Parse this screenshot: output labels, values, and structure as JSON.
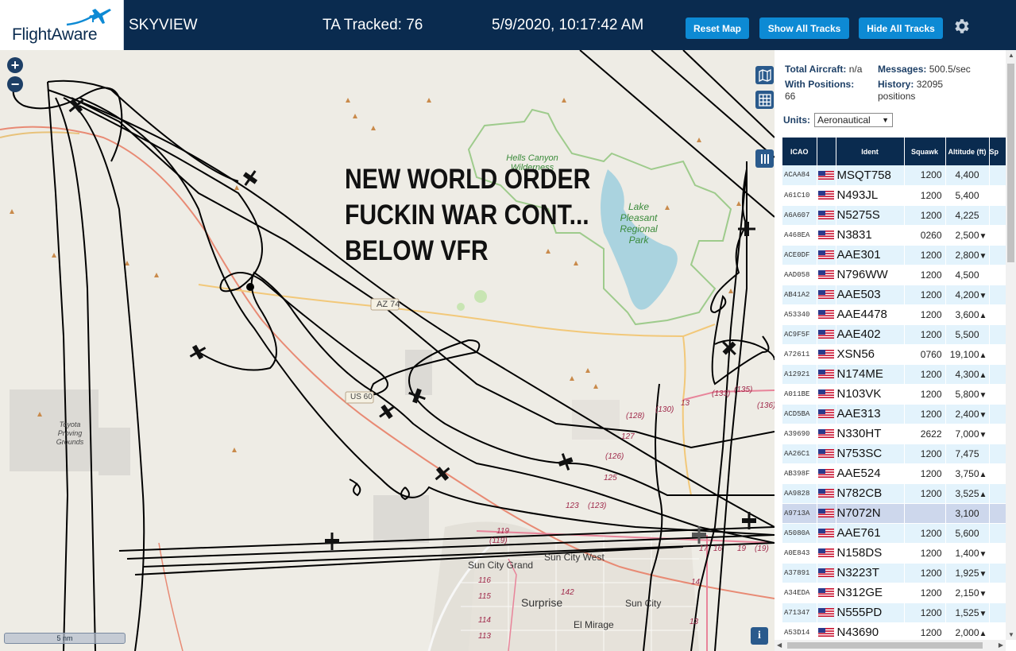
{
  "header": {
    "logo_text": "FlightAware",
    "app_name": "SKYVIEW",
    "tracked": "TA Tracked: 76",
    "datetime": "5/9/2020, 10:17:42 AM",
    "buttons": {
      "reset": "Reset Map",
      "show": "Show All Tracks",
      "hide": "Hide All Tracks"
    },
    "settings_icon": "gear-icon"
  },
  "map": {
    "overlay_lines": [
      "NEW WORLD ORDER",
      "FUCKIN WAR CONT...",
      "BELOW VFR"
    ],
    "scale": "5 nm",
    "labels": {
      "hells_canyon": "Hells Canyon Wilderness",
      "lake_pleasant": "Lake Pleasant Regional Park",
      "toyota": "Toyota Proving Grounds",
      "az74": "AZ 74",
      "us60": "US 60",
      "sun_city_grand": "Sun City Grand",
      "sun_city_west": "Sun City West",
      "surprise": "Surprise",
      "sun_city": "Sun City",
      "el_mirage": "El Mirage"
    },
    "road_numbers": [
      "(133)",
      "(135)",
      "(136)",
      "(128)",
      "127",
      "(130)",
      "13",
      "(126)",
      "125",
      "123",
      "(123)",
      "119",
      "(119)",
      "116",
      "115",
      "114",
      "113",
      "142",
      "17",
      "16",
      "19",
      "(19)",
      "14",
      "13"
    ],
    "zoom_in": "+",
    "zoom_out": "−",
    "info": "i"
  },
  "sidebar": {
    "stats": {
      "total_aircraft_label": "Total Aircraft:",
      "total_aircraft": "n/a",
      "messages_label": "Messages:",
      "messages": "500.5/sec",
      "with_positions_label": "With Positions:",
      "with_positions": "66",
      "history_label": "History:",
      "history": "32095 positions"
    },
    "units_label": "Units:",
    "units_value": "Aeronautical",
    "columns": [
      "ICAO",
      "",
      "Ident",
      "Squawk",
      "Altitude (ft)",
      "Sp"
    ],
    "rows": [
      {
        "icao": "ACAA84",
        "ident": "MSQT758",
        "squawk": "1200",
        "alt": "4,400",
        "trend": ""
      },
      {
        "icao": "A61C10",
        "ident": "N493JL",
        "squawk": "1200",
        "alt": "5,400",
        "trend": ""
      },
      {
        "icao": "A6A607",
        "ident": "N5275S",
        "squawk": "1200",
        "alt": "4,225",
        "trend": ""
      },
      {
        "icao": "A468EA",
        "ident": "N3831",
        "squawk": "0260",
        "alt": "2,500",
        "trend": "▼"
      },
      {
        "icao": "ACE0DF",
        "ident": "AAE301",
        "squawk": "1200",
        "alt": "2,800",
        "trend": "▼"
      },
      {
        "icao": "AAD058",
        "ident": "N796WW",
        "squawk": "1200",
        "alt": "4,500",
        "trend": ""
      },
      {
        "icao": "AB41A2",
        "ident": "AAE503",
        "squawk": "1200",
        "alt": "4,200",
        "trend": "▼"
      },
      {
        "icao": "A53340",
        "ident": "AAE4478",
        "squawk": "1200",
        "alt": "3,600",
        "trend": "▲"
      },
      {
        "icao": "AC9F5F",
        "ident": "AAE402",
        "squawk": "1200",
        "alt": "5,500",
        "trend": ""
      },
      {
        "icao": "A72611",
        "ident": "XSN56",
        "squawk": "0760",
        "alt": "19,100",
        "trend": "▲"
      },
      {
        "icao": "A12921",
        "ident": "N174ME",
        "squawk": "1200",
        "alt": "4,300",
        "trend": "▲"
      },
      {
        "icao": "A011BE",
        "ident": "N103VK",
        "squawk": "1200",
        "alt": "5,800",
        "trend": "▼"
      },
      {
        "icao": "ACD5BA",
        "ident": "AAE313",
        "squawk": "1200",
        "alt": "2,400",
        "trend": "▼"
      },
      {
        "icao": "A39690",
        "ident": "N330HT",
        "squawk": "2622",
        "alt": "7,000",
        "trend": "▼"
      },
      {
        "icao": "AA26C1",
        "ident": "N753SC",
        "squawk": "1200",
        "alt": "7,475",
        "trend": ""
      },
      {
        "icao": "AB398F",
        "ident": "AAE524",
        "squawk": "1200",
        "alt": "3,750",
        "trend": "▲"
      },
      {
        "icao": "AA9828",
        "ident": "N782CB",
        "squawk": "1200",
        "alt": "3,525",
        "trend": "▲"
      },
      {
        "icao": "A9713A",
        "ident": "N7072N",
        "squawk": "",
        "alt": "3,100",
        "trend": "",
        "selected": true
      },
      {
        "icao": "A5080A",
        "ident": "AAE761",
        "squawk": "1200",
        "alt": "5,600",
        "trend": ""
      },
      {
        "icao": "A0E843",
        "ident": "N158DS",
        "squawk": "1200",
        "alt": "1,400",
        "trend": "▼"
      },
      {
        "icao": "A37891",
        "ident": "N3223T",
        "squawk": "1200",
        "alt": "1,925",
        "trend": "▼"
      },
      {
        "icao": "A34EDA",
        "ident": "N312GE",
        "squawk": "1200",
        "alt": "2,150",
        "trend": "▼"
      },
      {
        "icao": "A71347",
        "ident": "N555PD",
        "squawk": "1200",
        "alt": "1,525",
        "trend": "▼"
      },
      {
        "icao": "A53D14",
        "ident": "N43690",
        "squawk": "1200",
        "alt": "2,000",
        "trend": "▲"
      }
    ]
  }
}
